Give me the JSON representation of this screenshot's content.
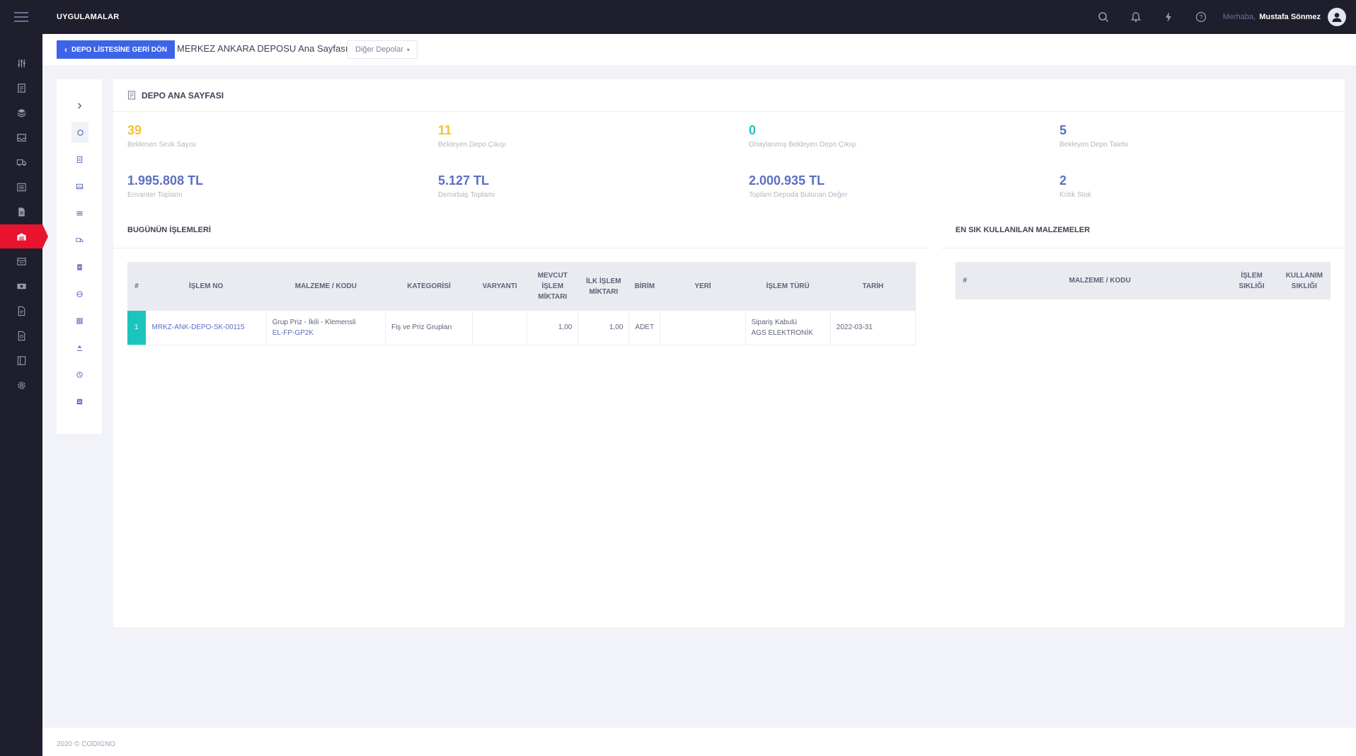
{
  "topbar": {
    "apps_label": "UYGULAMALAR",
    "greeting": "Merhaba,",
    "user_name": "Mustafa Sönmez",
    "icons": [
      "search-icon",
      "bell-icon",
      "lightning-icon",
      "help-icon",
      "avatar-icon"
    ]
  },
  "sidebar": {
    "icons": [
      "sliders-icon",
      "document-icon",
      "layers-icon",
      "inbox-icon",
      "truck-icon",
      "list-icon",
      "file-icon",
      "warehouse-icon",
      "store-icon",
      "money-icon",
      "invoice-icon",
      "receipt-icon",
      "book-icon",
      "settings-icon"
    ],
    "active_index": 7
  },
  "subheader": {
    "back_button": "DEPO LİSTESİNE GERİ DÖN",
    "title": "MERKEZ ANKARA DEPOSU Ana Sayfası",
    "other_depots": "Diğer Depolar"
  },
  "main": {
    "title": "DEPO ANA SAYFASI",
    "stats": [
      {
        "value": "39",
        "label": "Beklenen Sevk Sayısı",
        "color": "#f1c232"
      },
      {
        "value": "11",
        "label": "Bekleyen Depo Çıkışı",
        "color": "#f1c232"
      },
      {
        "value": "0",
        "label": "Onaylanmış Bekleyen Depo Çıkışı",
        "color": "#1bc5bd"
      },
      {
        "value": "5",
        "label": "Bekleyen Depo Talebi",
        "color": "#5c6fc1"
      },
      {
        "value": "1.995.808 TL",
        "label": "Envanter Toplamı",
        "color": "#5c6fc1"
      },
      {
        "value": "5.127 TL",
        "label": "Demirbaş Toplamı",
        "color": "#5c6fc1"
      },
      {
        "value": "2.000.935 TL",
        "label": "Toplam Depoda Bulunan Değer",
        "color": "#5c6fc1"
      },
      {
        "value": "2",
        "label": "Kritik Stok",
        "color": "#5c6fc1"
      }
    ],
    "today_section": {
      "title": "BUGÜNÜN İŞLEMLERİ",
      "columns": [
        "#",
        "İŞLEM NO",
        "MALZEME / KODU",
        "KATEGORİSİ",
        "VARYANTI",
        "MEVCUT İŞLEM MİKTARI",
        "İLK İŞLEM MİKTARI",
        "BİRİM",
        "YERİ",
        "İŞLEM TÜRÜ",
        "TARİH"
      ],
      "rows": [
        {
          "index": "1",
          "islem_no": "MRKZ-ANK-DEPO-SK-00115",
          "malzeme": "Grup Priz - İkili - Klemensli",
          "kod": "EL-FP-GP2K",
          "kategori": "Fiş ve Priz Grupları",
          "varyant": "",
          "mevcut": "1,00",
          "ilk": "1,00",
          "birim": "ADET",
          "yeri": "",
          "islem_turu": "Sipariş Kabulü",
          "firma": "AGS ELEKTRONİK",
          "tarih": "2022-03-31"
        }
      ]
    },
    "frequent_section": {
      "title": "EN SIK KULLANILAN MALZEMELER",
      "columns": [
        "#",
        "MALZEME / KODU",
        "İŞLEM SIKLIĞI",
        "KULLANIM SIKLIĞI"
      ]
    }
  },
  "footer": {
    "text": "2020 © CODIGNO"
  }
}
